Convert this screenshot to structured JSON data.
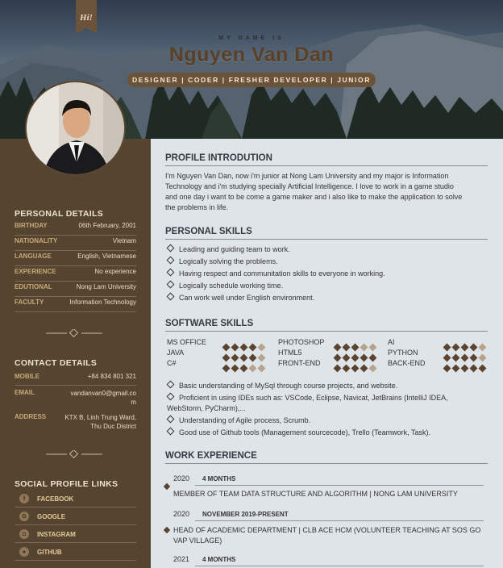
{
  "header": {
    "ribbon": "Hi!",
    "my_name_is": "MY NAME IS",
    "full_name": "Nguyen Van Dan",
    "roles": "DESIGNER | CODER | FRESHER DEVELOPER | JUNIOR"
  },
  "sidebar": {
    "personal_title": "PERSONAL DETAILS",
    "personal": [
      {
        "k": "BIRTHDAY",
        "v": "06th February, 2001"
      },
      {
        "k": "NATIONALITY",
        "v": "Vietnam"
      },
      {
        "k": "LANGUAGE",
        "v": "English, Vietnamese"
      },
      {
        "k": "EXPERIENCE",
        "v": "No experience"
      },
      {
        "k": "EDUTIONAL",
        "v": "Nong Lam University"
      },
      {
        "k": "FACULTY",
        "v": "Information Technology"
      }
    ],
    "contact_title": "CONTACT DETAILS",
    "contact": [
      {
        "k": "MOBILE",
        "v": "+84 834 801 321"
      },
      {
        "k": "EMAIL",
        "v1": "vandanvan0@gmail.co",
        "v2": "m"
      },
      {
        "k": "ADDRESS",
        "v1": "KTX B, Linh Trung Ward,",
        "v2": "Thu Duc District"
      }
    ],
    "social_title": "SOCIAL PROFILE LINKS",
    "social": [
      "FACEBOOK",
      "GOOGLE",
      "INSTAGRAM",
      "GITHUB"
    ]
  },
  "profile": {
    "title": "PROFILE INTRODUTION",
    "lines": [
      "I'm Nguyen Van Dan, now i'm junior at Nong Lam University and my major is Information",
      "Technology and i'm studying specially Artificial Intelligence. I love to work in a game studio",
      "and one day i want to be come a game maker and i also like to make the application to solve",
      "the problems in life."
    ]
  },
  "personal_skills": {
    "title": "PERSONAL SKILLS",
    "items": [
      "Leading and guiding team to work.",
      "Logically solving the problems.",
      "Having respect and communitation skills to everyone in working.",
      "Logically schedule working time.",
      "Can work well under English environment."
    ]
  },
  "software_skills": {
    "title": "SOFTWARE SKILLS",
    "items": [
      {
        "name": "MS OFFICE",
        "level": 4
      },
      {
        "name": "PHOTOSHOP",
        "level": 3
      },
      {
        "name": "AI",
        "level": 4
      },
      {
        "name": "JAVA",
        "level": 4
      },
      {
        "name": "HTML5",
        "level": 5
      },
      {
        "name": "PYTHON",
        "level": 4
      },
      {
        "name": "C#",
        "level": 3
      },
      {
        "name": "FRONT-END",
        "level": 4
      },
      {
        "name": "BACK-END",
        "level": 5
      }
    ],
    "notes": [
      "Basic understanding of MySql through course projects, and website.",
      "Proficient in using IDEs such as: VSCode, Eclipse, Navicat, JetBrains (IntelliJ IDEA,",
      "WebStorm, PyCharm),...",
      "Understanding of Agile process, Scrumb.",
      "Good use of Github tools (Management sourcecode), Trello (Teamwork, Task)."
    ],
    "colors": {
      "filled": "#5a4430",
      "empty": "#b7a38a"
    }
  },
  "work": {
    "title": "WORK EXPERIENCE",
    "entries": [
      {
        "year": "2020",
        "dur": "4 MONTHS",
        "role": "MEMBER OF TEAM DATA STRUCTURE AND ALGORITHM | NONG LAM UNIVERSITY",
        "role2": ""
      },
      {
        "year": "2020",
        "dur": "NOVEMBER 2019-PRESENT",
        "role": "HEAD OF ACADEMIC DEPARTMENT | CLB ACE HCM (VOLUNTEER TEACHING AT SOS GO",
        "role2": "VAP VILLAGE)"
      },
      {
        "year": "2021",
        "dur": "4 MONTHS",
        "role": "",
        "role2": ""
      }
    ]
  }
}
